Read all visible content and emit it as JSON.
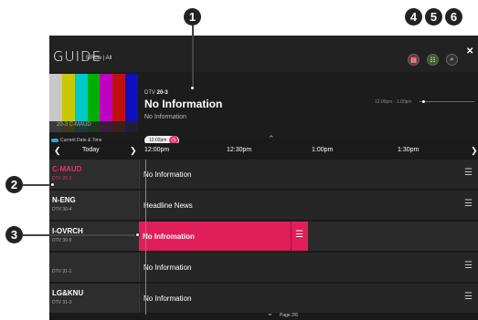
{
  "header": {
    "title": "GUIDE",
    "subtitle": "5 Row | All"
  },
  "header_buttons": {
    "red": "▤",
    "green": "☷",
    "search": "⌕",
    "close": "✕"
  },
  "preview": {
    "channel_prefix": "DTV",
    "channel_number": "20-3",
    "program_title": "No Information",
    "program_subtitle": "No Information",
    "time_range": "12:00pm - 1:00pm",
    "bars_label": "20-3 C-MAUD",
    "bar_colors": [
      "#c8c8c8",
      "#c8c800",
      "#00c8c8",
      "#00b000",
      "#c000c0",
      "#c01010",
      "#1010c0"
    ]
  },
  "legend": {
    "label": "Current Date & Time",
    "color": "#2aa8e0"
  },
  "timeline": {
    "now_time": "12:02pm",
    "today": "Today",
    "ticks": [
      "12:00pm",
      "12:30pm",
      "1:00pm",
      "1:30pm"
    ]
  },
  "rows": [
    {
      "channel": "C-MAUD",
      "sub": "DTV 20-3",
      "program": "No Information"
    },
    {
      "channel": "N-ENG",
      "sub": "DTV 30-4",
      "program": "Headline News"
    },
    {
      "channel": "I-OVRCH",
      "sub": "DTV 30-5",
      "program": "No Infromation"
    },
    {
      "channel": "",
      "sub": "DTV 31-1",
      "program": "No Information"
    },
    {
      "channel": "LG&KNU",
      "sub": "DTV 31-3",
      "program": "No Information"
    }
  ],
  "page_indicator": "Page 2/6",
  "callouts": [
    "1",
    "2",
    "3",
    "4",
    "5",
    "6"
  ],
  "accent_color": "#e01e5a"
}
